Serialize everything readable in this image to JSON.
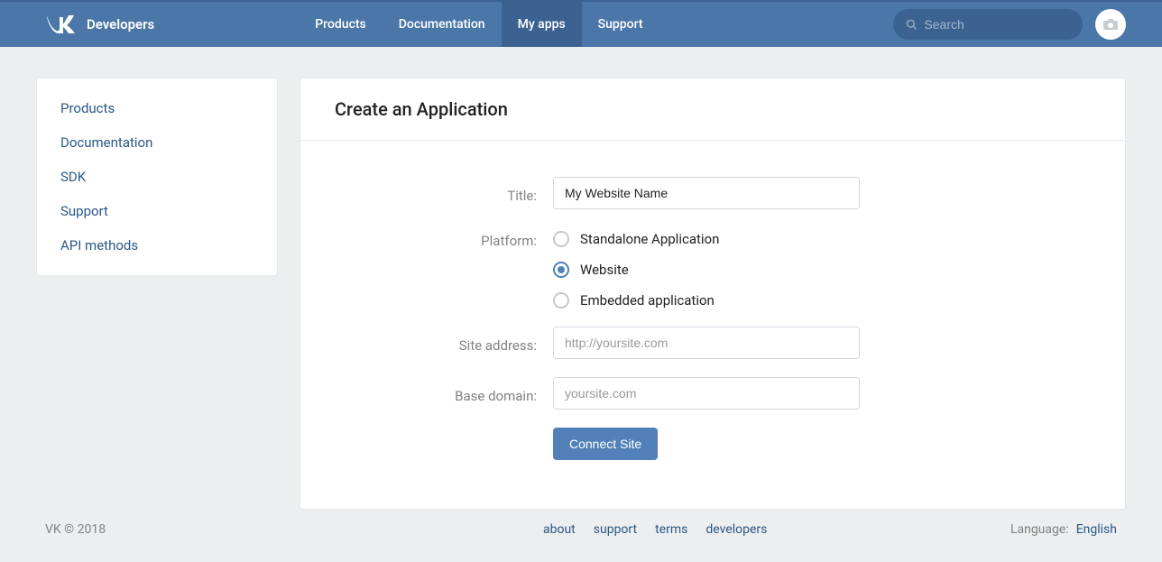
{
  "header": {
    "brand": "Developers",
    "nav": [
      "Products",
      "Documentation",
      "My apps",
      "Support"
    ],
    "active_nav_index": 2,
    "search_placeholder": "Search"
  },
  "sidebar": {
    "items": [
      "Products",
      "Documentation",
      "SDK",
      "Support",
      "API methods"
    ]
  },
  "main": {
    "title": "Create an Application",
    "labels": {
      "title": "Title:",
      "platform": "Platform:",
      "site_address": "Site address:",
      "base_domain": "Base domain:"
    },
    "fields": {
      "title_value": "My Website Name",
      "site_address_placeholder": "http://yoursite.com",
      "site_address_value": "",
      "base_domain_placeholder": "yoursite.com",
      "base_domain_value": ""
    },
    "platform_options": [
      "Standalone Application",
      "Website",
      "Embedded application"
    ],
    "platform_selected_index": 1,
    "submit_label": "Connect Site"
  },
  "footer": {
    "copyright": "VK © 2018",
    "links": [
      "about",
      "support",
      "terms",
      "developers"
    ],
    "language_label": "Language:",
    "language_value": "English"
  }
}
